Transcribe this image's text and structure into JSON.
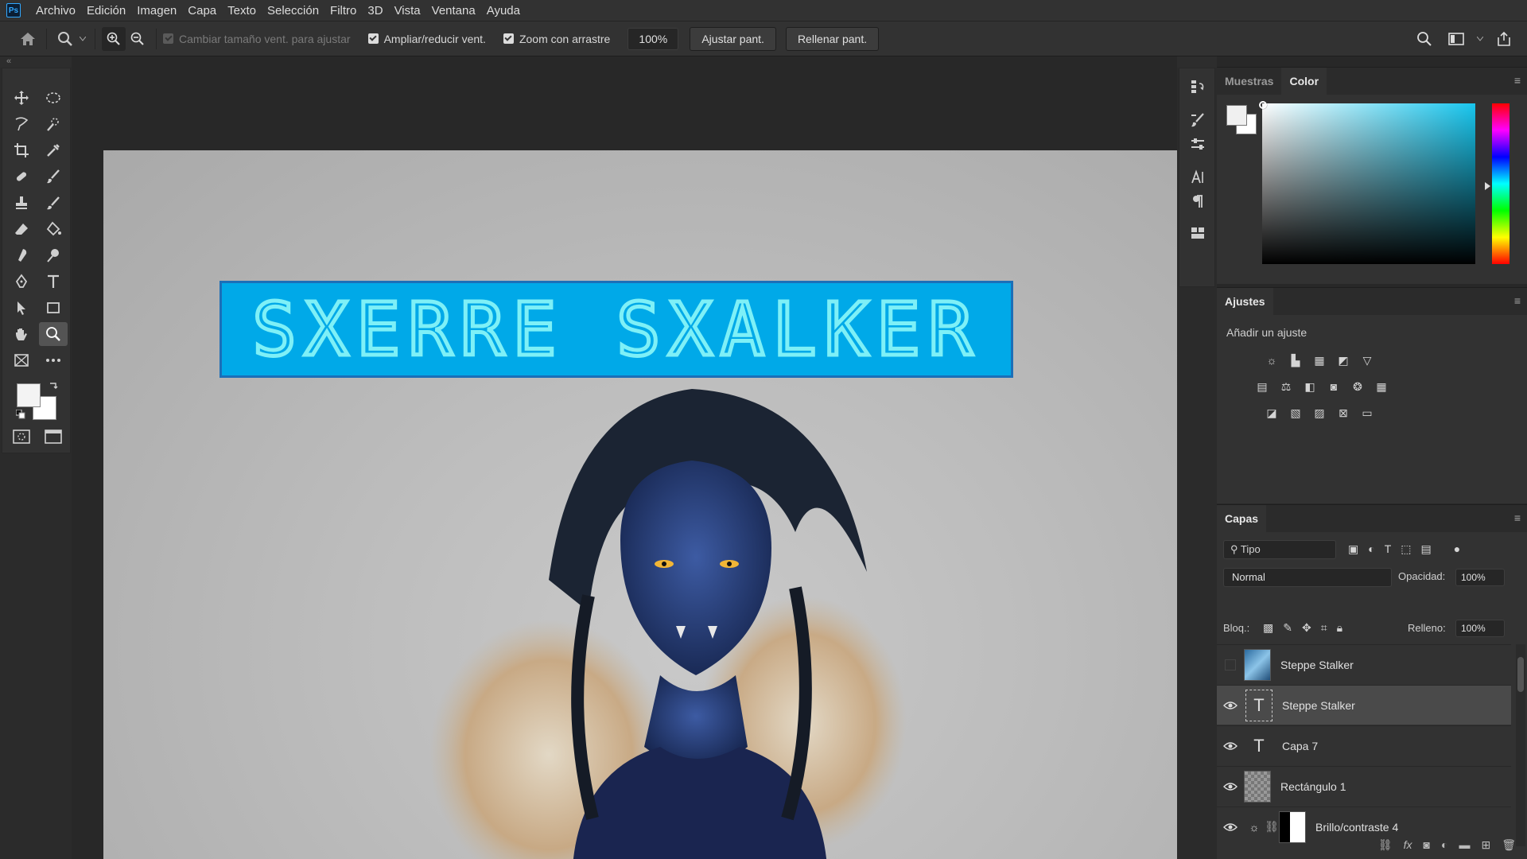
{
  "app": {
    "logo": "Ps"
  },
  "menu": [
    "Archivo",
    "Edición",
    "Imagen",
    "Capa",
    "Texto",
    "Selección",
    "Filtro",
    "3D",
    "Vista",
    "Ventana",
    "Ayuda"
  ],
  "options": {
    "resize_window": "Cambiar tamaño vent. para ajustar",
    "zoom_all": "Ampliar/reducir vent.",
    "scrubby_zoom": "Zoom con arrastre",
    "zoom_value": "100%",
    "fit_screen": "Ajustar pant.",
    "fill_screen": "Rellenar pant."
  },
  "canvas": {
    "banner_text": "SXERRE SXALKER"
  },
  "color_panel": {
    "tab_swatches": "Muestras",
    "tab_color": "Color",
    "accent": "#18c6ee"
  },
  "adjustments": {
    "tab": "Ajustes",
    "subtitle": "Añadir un ajuste"
  },
  "layers": {
    "tab": "Capas",
    "filter_kind": "Tipo",
    "blend_mode": "Normal",
    "opacity_label": "Opacidad:",
    "opacity_value": "100%",
    "lock_label": "Bloq.:",
    "fill_label": "Relleno:",
    "fill_value": "100%",
    "items": [
      {
        "name": "Steppe Stalker",
        "visible": false,
        "kind": "image"
      },
      {
        "name": "Steppe Stalker",
        "visible": true,
        "kind": "text",
        "selected": true
      },
      {
        "name": "Capa 7",
        "visible": true,
        "kind": "text"
      },
      {
        "name": "Rectángulo 1",
        "visible": true,
        "kind": "shape"
      },
      {
        "name": "Brillo/contraste 4",
        "visible": true,
        "kind": "adjustment"
      }
    ]
  }
}
